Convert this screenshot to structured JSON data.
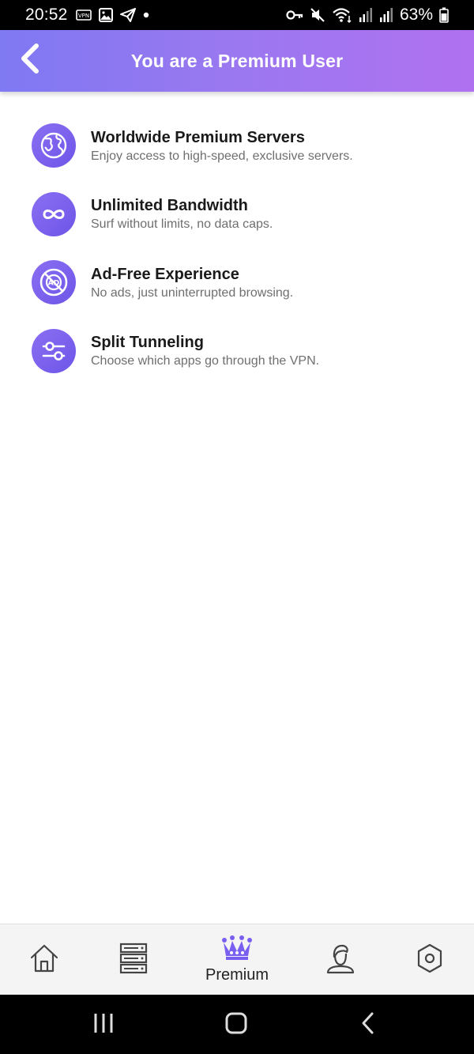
{
  "status_bar": {
    "time": "20:52",
    "battery": "63%",
    "icons_left": [
      "vpn-icon",
      "image-icon",
      "telegram-icon",
      "dot-icon"
    ],
    "icons_right": [
      "key-icon",
      "mute-icon",
      "wifi-icon",
      "signal-icon",
      "signal-icon",
      "battery-icon"
    ]
  },
  "header": {
    "title": "You are a Premium User",
    "back_icon": "chevron-left-icon"
  },
  "features": [
    {
      "icon": "globe-icon",
      "title": "Worldwide Premium Servers",
      "description": "Enjoy access to high-speed, exclusive servers."
    },
    {
      "icon": "infinity-icon",
      "title": "Unlimited Bandwidth",
      "description": "Surf without limits, no data caps."
    },
    {
      "icon": "ad-block-icon",
      "title": "Ad-Free Experience",
      "description": "No ads, just uninterrupted browsing."
    },
    {
      "icon": "sliders-icon",
      "title": "Split Tunneling",
      "description": "Choose which apps go through the VPN."
    }
  ],
  "bottom_nav": {
    "items": [
      {
        "icon": "home-icon",
        "label": ""
      },
      {
        "icon": "servers-icon",
        "label": ""
      },
      {
        "icon": "crown-icon",
        "label": "Premium",
        "active": true
      },
      {
        "icon": "user-icon",
        "label": ""
      },
      {
        "icon": "settings-icon",
        "label": ""
      }
    ]
  },
  "colors": {
    "accent": "#7a5ef0",
    "header_gradient_start": "#7f79f2",
    "header_gradient_end": "#b071f0",
    "nav_background": "#f4f4f5"
  }
}
